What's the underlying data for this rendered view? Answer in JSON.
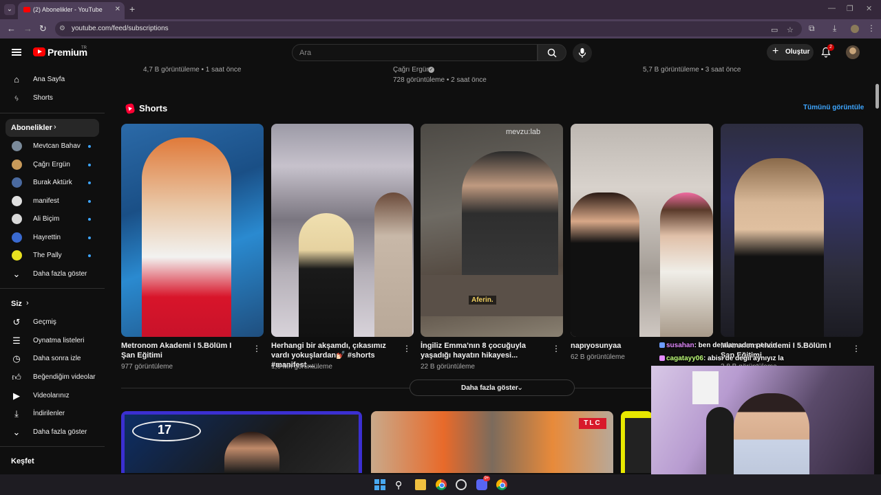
{
  "browser": {
    "tab_title": "(2) Abonelikler - YouTube",
    "url": "youtube.com/feed/subscriptions"
  },
  "header": {
    "logo_text": "Premium",
    "logo_region": "TR",
    "search_placeholder": "Ara",
    "create_label": "Oluştur",
    "notification_count": "2"
  },
  "sidebar": {
    "main": [
      {
        "label": "Ana Sayfa",
        "icon": "home-icon"
      },
      {
        "label": "Shorts",
        "icon": "shorts-icon"
      }
    ],
    "subscriptions_title": "Abonelikler",
    "channels": [
      {
        "label": "Mevtcan Bahav",
        "color": "#7a8a9a"
      },
      {
        "label": "Çağrı Ergün",
        "color": "#c89a5a"
      },
      {
        "label": "Burak Aktürk",
        "color": "#4a6aa0"
      },
      {
        "label": "manifest",
        "color": "#e0e0e0"
      },
      {
        "label": "Ali Biçim",
        "color": "#d8d8d8"
      },
      {
        "label": "Hayrettin",
        "color": "#3a6ad0"
      },
      {
        "label": "The Pally",
        "color": "#e8e020"
      }
    ],
    "channels_more": "Daha fazla göster",
    "you_title": "Siz",
    "you_items": [
      {
        "label": "Geçmiş",
        "icon": "history-icon"
      },
      {
        "label": "Oynatma listeleri",
        "icon": "playlists-icon"
      },
      {
        "label": "Daha sonra izle",
        "icon": "clock-icon"
      },
      {
        "label": "Beğendiğim videolar",
        "icon": "thumbs-up-icon"
      },
      {
        "label": "Videolarınız",
        "icon": "your-videos-icon"
      },
      {
        "label": "İndirilenler",
        "icon": "download-icon"
      },
      {
        "label": "Daha fazla göster",
        "icon": "chevron-down-icon"
      }
    ],
    "explore_title": "Keşfet"
  },
  "top_meta": {
    "col1": "4,7 B görüntüleme • 1 saat önce",
    "col2_channel": "Çağrı Ergün",
    "col2": "728 görüntüleme • 2 saat önce",
    "col3": "5,7 B görüntüleme • 3 saat önce"
  },
  "shorts": {
    "title": "Shorts",
    "see_all": "Tümünü görüntüle",
    "items": [
      {
        "title": "Metronom Akademi I 5.Bölüm I Şan Eğitimi",
        "views": "977 görüntüleme"
      },
      {
        "title": "Herhangi bir akşamdı, çıkasımız vardı yokuşlardan💅🏻 #shorts #manifest ...",
        "views": "1,6 Mn görüntüleme"
      },
      {
        "title": "İngiliz Emma'nın 8 çocuğuyla yaşadığı hayatın hikayesi...",
        "views": "22 B görüntüleme",
        "overlay_brand": "mevzu:lab",
        "caption": "Aferin."
      },
      {
        "title": "napıyosunyaa",
        "views": "62 B görüntüleme"
      },
      {
        "title": "Metronom Akademi I 5.Bölüm I Şan Eğitimi",
        "views": "2,8 B görüntüleme"
      }
    ],
    "more_label": "Daha fazla göster"
  },
  "videos": {
    "v1_number": "17",
    "v2_badge": "TLC"
  },
  "stream_overlay": {
    "chat": [
      {
        "user": "susahan",
        "message": ": ben de alamadım pervin"
      },
      {
        "user": "cagatayy06",
        "message": ": abisi de değil aynıyız la"
      }
    ]
  },
  "taskbar": {
    "discord_badge": "9+"
  }
}
